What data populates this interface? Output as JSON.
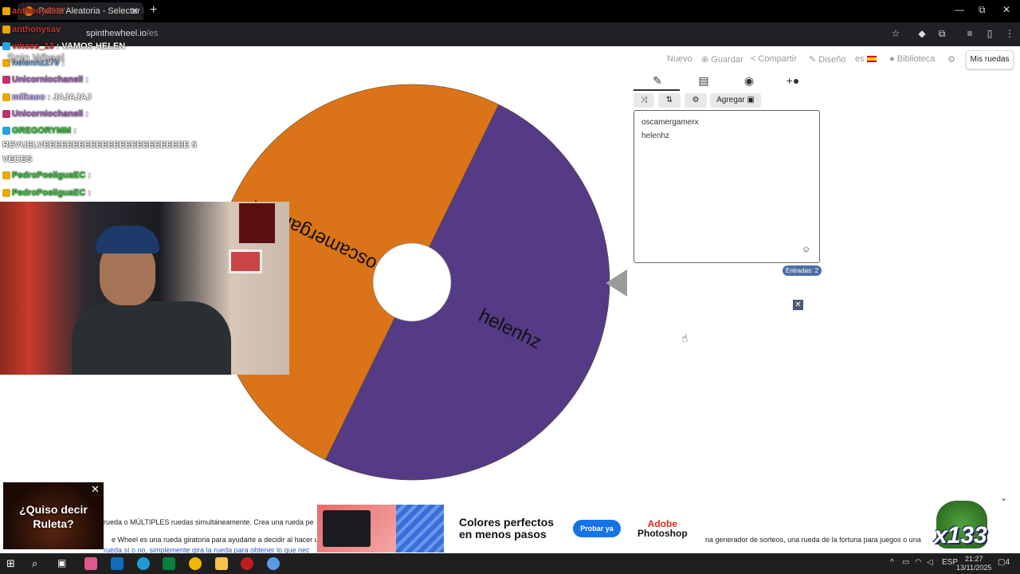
{
  "browser": {
    "tab_title": "Ruleta Aleatoria - Selector Pers...",
    "close_tab": "✕",
    "new_tab": "+",
    "url_domain": "spinthewheel.io",
    "url_path": "/es",
    "minimize": "—",
    "restore": "⧉",
    "close": "✕"
  },
  "site": {
    "logo": "Spin Wheel",
    "nav": {
      "nuevo": "Nuevo",
      "guardar": "Guardar",
      "compartir": "Compartir",
      "diseno": "Diseño",
      "lang": "es",
      "biblioteca": "Biblioteca",
      "mis_ruedas": "Mis ruedas"
    }
  },
  "wheel": {
    "segments": [
      {
        "label": "helenhz",
        "color": "#553a86"
      },
      {
        "label": "oscamergamerx",
        "color": "#db7418"
      }
    ]
  },
  "panel": {
    "tabs": [
      "edit-icon",
      "results-icon",
      "hide-icon",
      "add-color-icon"
    ],
    "add_button": "Agregar",
    "entries": [
      "oscamergamerx",
      "helenhz"
    ],
    "count_label": "Entradas: 2"
  },
  "chat": [
    {
      "user": "anthony0927",
      "msg": "",
      "color": "#c0392b"
    },
    {
      "user": "anthonysav",
      "msg": "",
      "color": "#c0392b"
    },
    {
      "user": "vinces_13",
      "msg": ": VAMOS HELEN",
      "color": "#e03030"
    },
    {
      "user": "helenhz279",
      "msg": ":",
      "color": "#7bb0e8"
    },
    {
      "user": "Unicorniochanell",
      "msg": ":",
      "color": "#b06cc8"
    },
    {
      "user": "milkaoo",
      "msg": ": JAJAJAJ",
      "color": "#c8b0ff"
    },
    {
      "user": "Unicorniochanell",
      "msg": ":",
      "color": "#b06cc8"
    },
    {
      "user": "GREGORYMM",
      "msg": ":",
      "color": "#35d235"
    },
    {
      "user": "",
      "msg": "REVUELVEEEEEEEEEEEEEEEEEEEEEEEEE 5",
      "color": "#fff"
    },
    {
      "user": "",
      "msg": "VECES",
      "color": "#fff"
    },
    {
      "user": "PedroPoeliguaEC",
      "msg": ":",
      "color": "#3bd13b"
    },
    {
      "user": "PedroPoeliguaEC",
      "msg": ":",
      "color": "#3bd13b"
    }
  ],
  "bottom": {
    "text_1": "rueda o MÚLTIPLES ruedas simultáneamente. Crea una rueda pe",
    "text_2": "e Wheel es una rueda giratoria para ayudarte a decidir al hacer u",
    "text_3": "rueda sí o no, simplemente gira la rueda para obtener lo que nec",
    "text_4": "na generador de sorteos, una rueda de la fortuna para juegos o una",
    "ad_left": "¿Quiso decir Ruleta?",
    "ad_headline": "Colores perfectos en menos pasos",
    "ad_cta": "Probar ya",
    "ad_brand_1": "Adobe",
    "ad_brand_2": "Photoshop",
    "overlay_count": "x133"
  },
  "taskbar": {
    "lang": "ESP",
    "time": "21:27",
    "date": "13/11/2025",
    "notifications": "4"
  }
}
